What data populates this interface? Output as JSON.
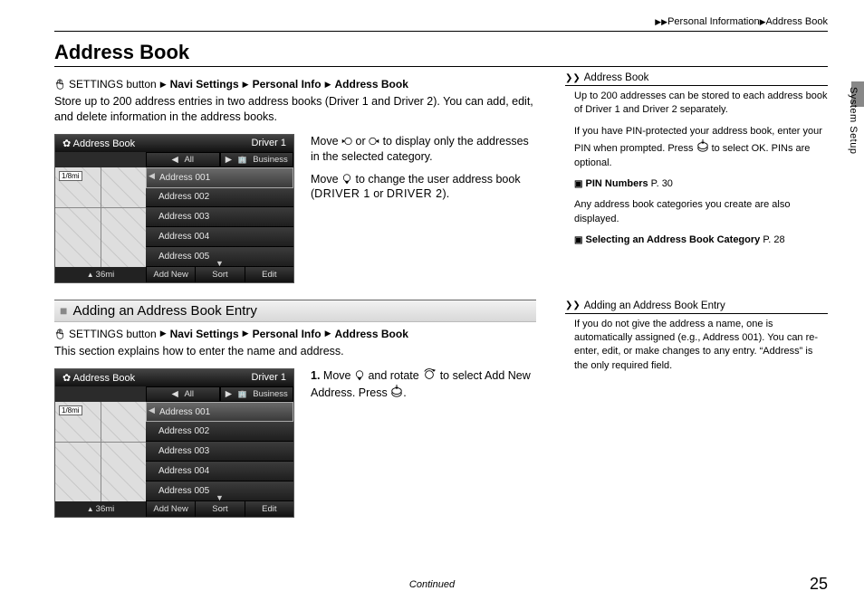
{
  "breadcrumb": {
    "a": "Personal Information",
    "b": "Address Book"
  },
  "title": "Address Book",
  "path": {
    "settings": "SETTINGS button",
    "navi": "Navi Settings",
    "pinfo": "Personal Info",
    "abook": "Address Book"
  },
  "intro": "Store up to 200 address entries in two address books (Driver 1 and Driver 2). You can add, edit, and delete information in the address books.",
  "desc1a": "Move ",
  "desc1b": " or ",
  "desc1c": " to display only the addresses in the selected category.",
  "desc2a": "Move ",
  "desc2b": " to change the user address book (",
  "desc2c": "DRIVER 1",
  "desc2d": " or ",
  "desc2e": "DRIVER 2",
  "desc2f": ").",
  "sub_heading": "Adding an Address Book Entry",
  "sub_intro": "This section explains how to enter the name and address.",
  "step1a": "Move ",
  "step1b": " and rotate ",
  "step1c": " to select ",
  "step1d": "Add New Address",
  "step1e": ". Press ",
  "step1f": ".",
  "device": {
    "title": "Address Book",
    "driver": "Driver 1",
    "tab_all": "All",
    "tab_business": "Business",
    "items": [
      "Address 001",
      "Address 002",
      "Address 003",
      "Address 004",
      "Address 005"
    ],
    "scale1": "1/8mi",
    "footer_scale": "36mi",
    "f_add": "Add New",
    "f_sort": "Sort",
    "f_edit": "Edit"
  },
  "side1": {
    "head": "Address Book",
    "p1": "Up to 200 addresses can be stored to each address book of Driver 1 and Driver 2 separately.",
    "p2a": "If you have PIN-protected your address book, enter your PIN when prompted. Press ",
    "p2b": " to select ",
    "p2c": "OK",
    "p2d": ". PINs are optional.",
    "xref1": "PIN Numbers",
    "xref1p": "P. 30",
    "p3": "Any address book categories you create are also displayed.",
    "xref2": "Selecting an Address Book Category",
    "xref2p": "P. 28"
  },
  "side2": {
    "head": "Adding an Address Book Entry",
    "p1": "If you do not give the address a name, one is automatically assigned (e.g., Address 001). You can re-enter, edit, or make changes to any entry. “Address” is the only required field."
  },
  "continued": "Continued",
  "page_number": "25",
  "side_tab": "System Setup"
}
